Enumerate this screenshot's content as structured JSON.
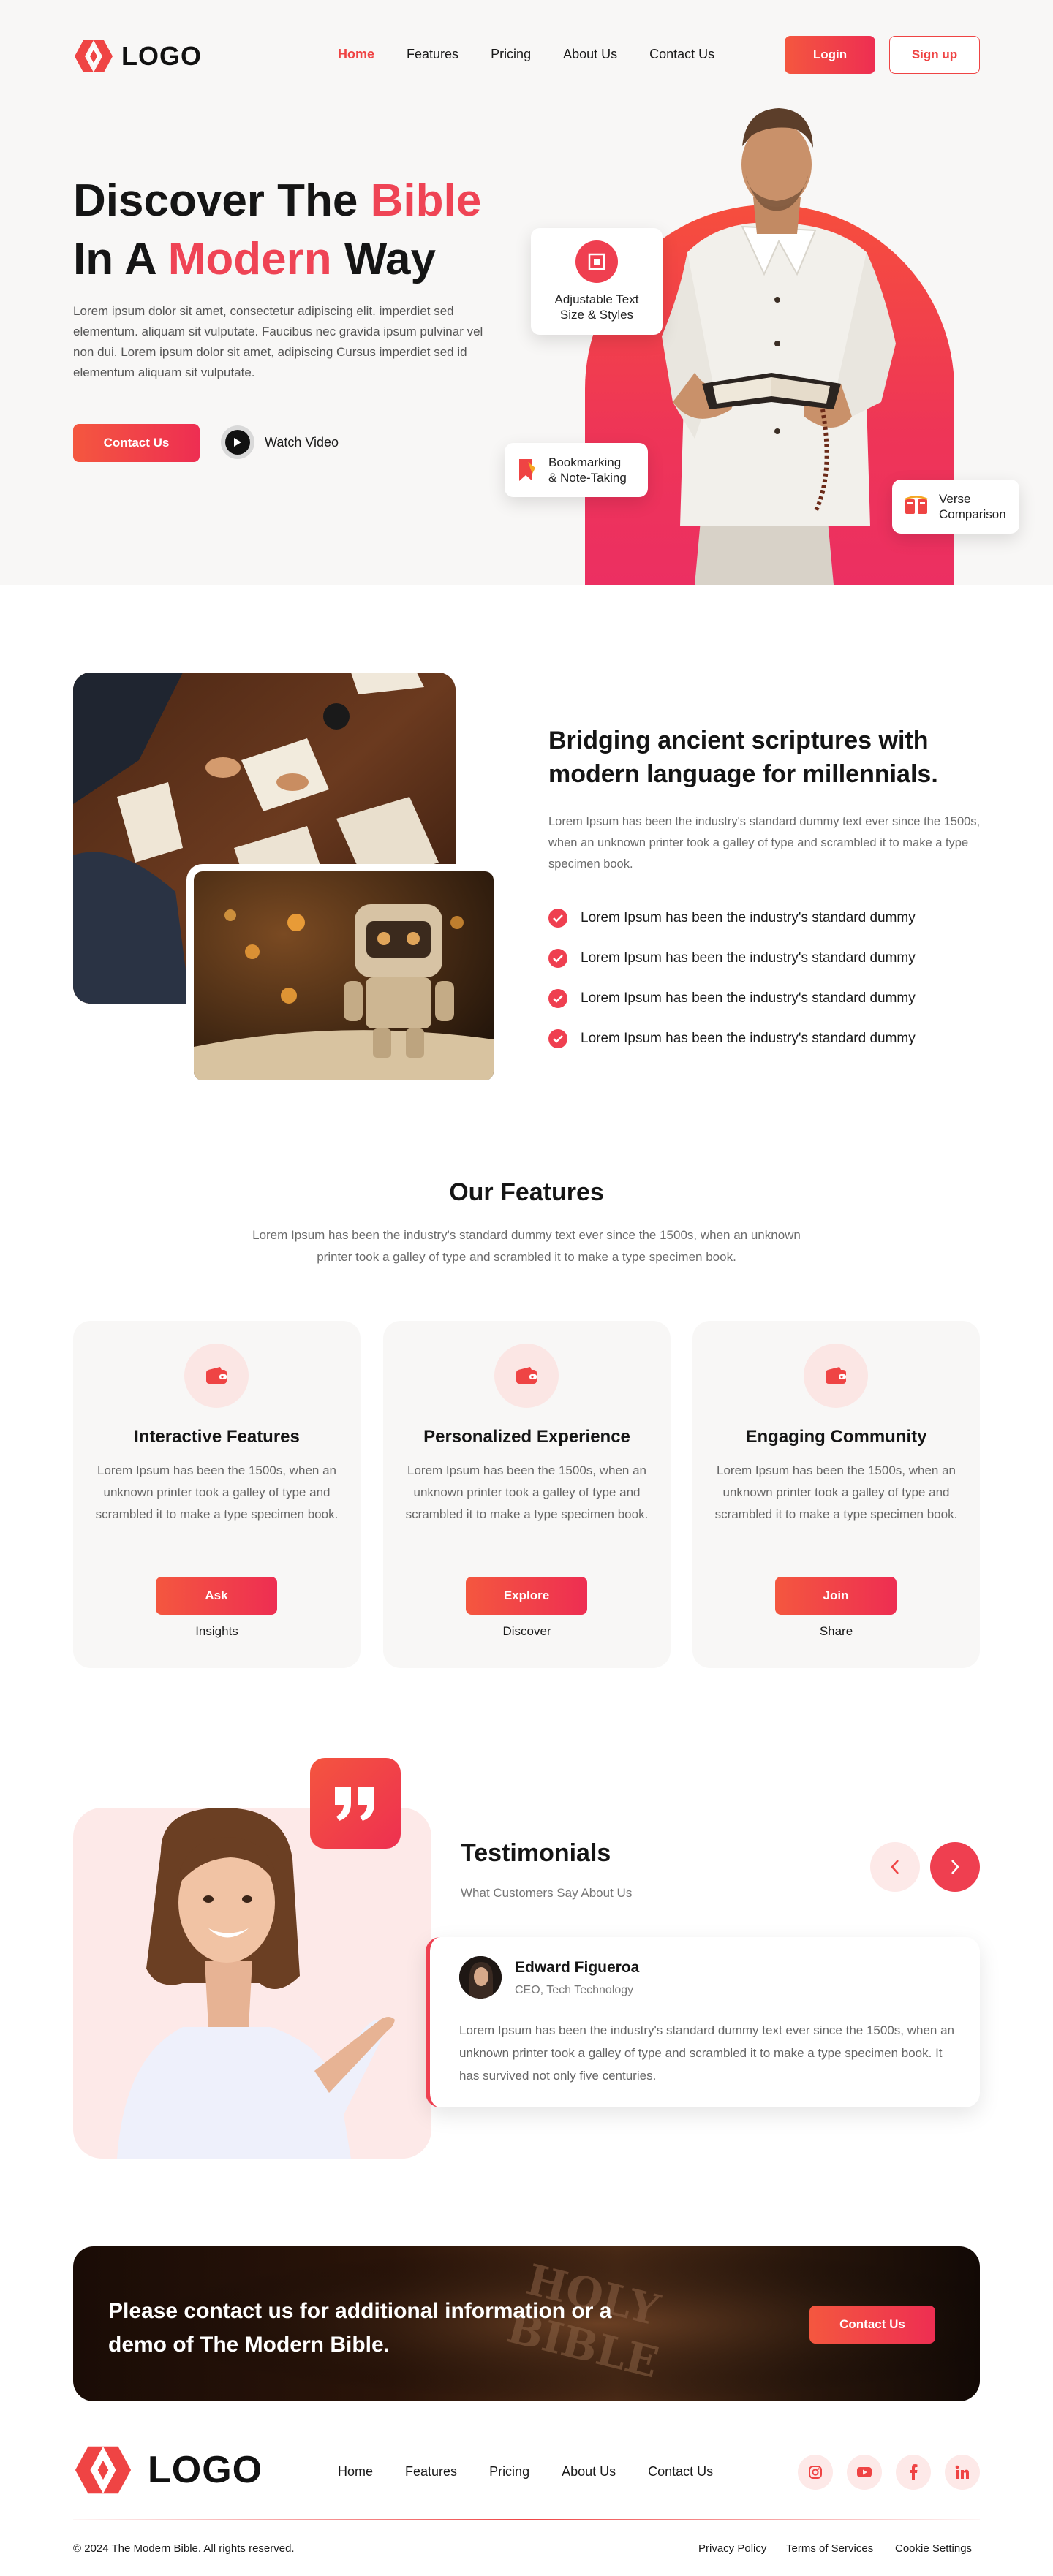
{
  "brand": {
    "logo_text": "LOGO",
    "accent_color": "#ef4444"
  },
  "nav": {
    "items": [
      {
        "label": "Home",
        "active": true
      },
      {
        "label": "Features",
        "active": false
      },
      {
        "label": "Pricing",
        "active": false
      },
      {
        "label": "About Us",
        "active": false
      },
      {
        "label": "Contact Us",
        "active": false
      }
    ],
    "login_label": "Login",
    "signup_label": "Sign up"
  },
  "hero": {
    "title_part1": "Discover The ",
    "title_accent1": "Bible",
    "title_part2": "In A ",
    "title_accent2": "Modern",
    "title_part3": " Way",
    "description": "Lorem ipsum dolor sit amet, consectetur adipiscing elit. imperdiet sed elementum. aliquam sit vulputate. Faucibus nec gravida ipsum pulvinar vel non dui. Lorem ipsum dolor sit amet, adipiscing Cursus imperdiet sed id elementum aliquam sit vulputate.",
    "contact_label": "Contact Us",
    "watch_label": "Watch Video",
    "cards": [
      {
        "label_line1": "Adjustable Text",
        "label_line2": "Size & Styles",
        "icon": "text-size-icon"
      },
      {
        "label_line1": "Bookmarking",
        "label_line2": "& Note-Taking",
        "icon": "bookmark-icon"
      },
      {
        "label_line1": "Verse",
        "label_line2": "Comparison",
        "icon": "book-compare-icon"
      }
    ]
  },
  "about": {
    "title": "Bridging ancient scriptures with modern language for millennials.",
    "description": "Lorem Ipsum has been the industry's standard dummy text ever since the 1500s, when an unknown printer took a galley of type and scrambled it to make a type specimen book.",
    "checklist": [
      "Lorem Ipsum has been the industry's standard dummy",
      "Lorem Ipsum has been the industry's standard dummy",
      "Lorem Ipsum has been the industry's standard dummy",
      "Lorem Ipsum has been the industry's standard dummy"
    ]
  },
  "features": {
    "title": "Our Features",
    "subtitle": "Lorem Ipsum has been the industry's standard dummy text ever since the 1500s, when an unknown printer took a galley of type and scrambled it to make a type specimen book.",
    "cards": [
      {
        "title": "Interactive Features",
        "description": "Lorem Ipsum has been the 1500s, when an unknown printer took a galley of type and scrambled it to make a type specimen book.",
        "button": "Ask",
        "caption": "Insights"
      },
      {
        "title": "Personalized Experience",
        "description": "Lorem Ipsum has been the 1500s, when an unknown printer took a galley of type and scrambled it to make a type specimen book.",
        "button": "Explore",
        "caption": "Discover"
      },
      {
        "title": "Engaging Community",
        "description": "Lorem Ipsum has been the 1500s, when an unknown printer took a galley of type and scrambled it to make a type specimen book.",
        "button": "Join",
        "caption": "Share"
      }
    ]
  },
  "testimonials": {
    "title": "Testimonials",
    "subtitle": "What Customers Say About Us",
    "name": "Edward Figueroa",
    "role": "CEO, Tech Technology",
    "text": "Lorem Ipsum has been the industry's standard dummy text ever since the 1500s, when an unknown printer took a galley of type and scrambled it to make a type specimen book. It has survived not only five centuries."
  },
  "cta": {
    "text": "Please contact us for additional information or a demo of The Modern Bible.",
    "button": "Contact Us",
    "background_text_line1": "HOLY",
    "background_text_line2": "BIBLE"
  },
  "footer": {
    "logo_text": "LOGO",
    "nav": [
      "Home",
      "Features",
      "Pricing",
      "About Us",
      "Contact Us"
    ],
    "social": [
      "instagram-icon",
      "youtube-icon",
      "facebook-icon",
      "linkedin-icon"
    ],
    "copyright": "© 2024 The Modern Bible. All rights reserved.",
    "legal": [
      "Privacy Policy",
      "Terms of Services",
      "Cookie Settings"
    ]
  }
}
